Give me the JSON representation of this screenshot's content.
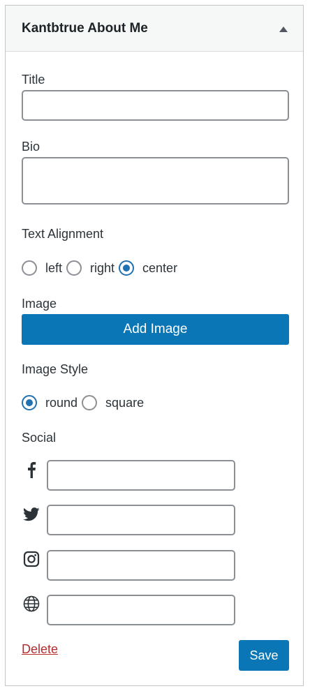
{
  "widget": {
    "title": "Kantbtrue About Me"
  },
  "form": {
    "title_label": "Title",
    "title_value": "",
    "bio_label": "Bio",
    "bio_value": "",
    "alignment_label": "Text Alignment",
    "alignment_options": [
      {
        "label": "left",
        "checked": false
      },
      {
        "label": "right",
        "checked": false
      },
      {
        "label": "center",
        "checked": true
      }
    ],
    "image_label": "Image",
    "add_image_button": "Add Image",
    "image_style_label": "Image Style",
    "image_style_options": [
      {
        "label": "round",
        "checked": true
      },
      {
        "label": "square",
        "checked": false
      }
    ],
    "social_label": "Social",
    "social_fields": [
      {
        "icon": "facebook-icon",
        "value": ""
      },
      {
        "icon": "twitter-icon",
        "value": ""
      },
      {
        "icon": "instagram-icon",
        "value": ""
      },
      {
        "icon": "globe-icon",
        "value": ""
      }
    ]
  },
  "actions": {
    "delete_label": "Delete",
    "save_label": "Save"
  },
  "colors": {
    "accent": "#0a76b6",
    "radio_checked": "#2271b1",
    "delete": "#b32d2e"
  }
}
